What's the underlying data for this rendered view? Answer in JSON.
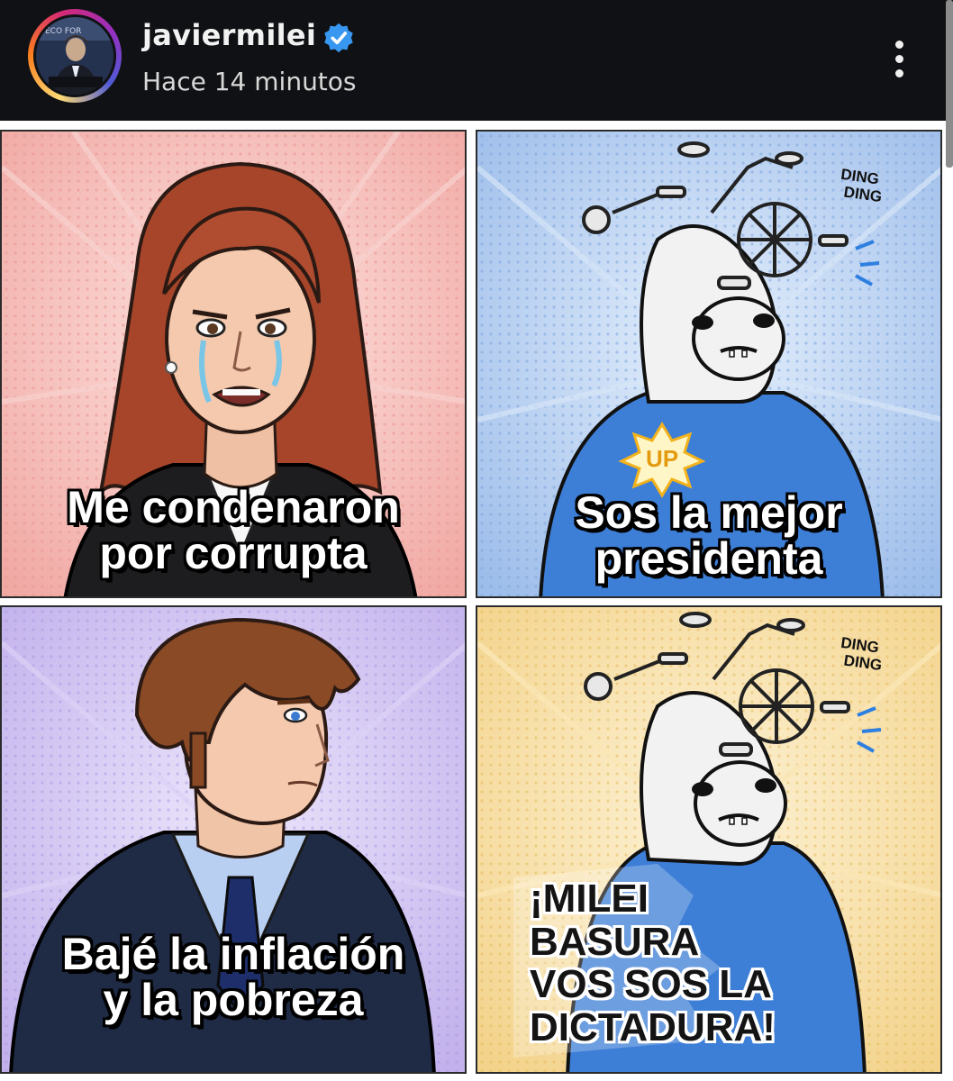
{
  "story": {
    "username": "javiermilei",
    "timestamp": "Hace 14 minutos",
    "verified": true,
    "icons": {
      "verified": "verified-badge-icon",
      "more": "more-options-icon"
    }
  },
  "panels": [
    {
      "lines": [
        "Me condenaron",
        "por corrupta"
      ],
      "background": "#f4b9b5"
    },
    {
      "lines": [
        "Sos la mejor",
        "presidenta"
      ],
      "badge": "UP",
      "sfx": [
        "DING",
        "DING"
      ],
      "background": "#a9c7ef"
    },
    {
      "lines": [
        "Bajé la inflación",
        "y la pobreza"
      ],
      "background": "#cbbdf0"
    },
    {
      "lines": [
        "¡MILEI",
        "BASURA",
        "VOS SOS LA",
        "DICTADURA!"
      ],
      "sfx": [
        "DING",
        "DING"
      ],
      "background": "#f6dc9c"
    }
  ],
  "colors": {
    "header_bg": "#101114",
    "verified_blue": "#3897f0",
    "panel_border": "#2b2b2b"
  }
}
